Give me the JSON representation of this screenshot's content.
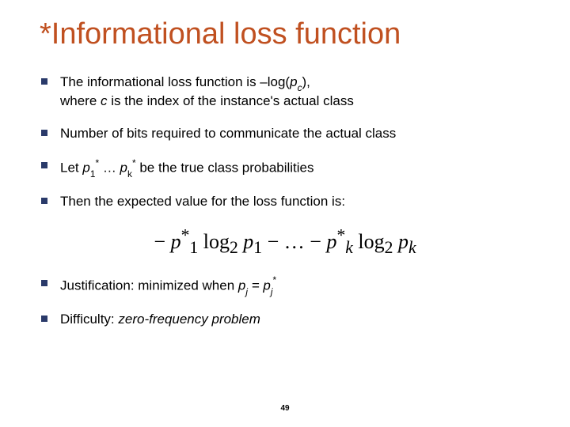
{
  "title": "*Informational loss function",
  "bullets": {
    "b1a": "The informational loss function is –log(",
    "b1_pc_p": "p",
    "b1_pc_c": "c",
    "b1b": "),",
    "b1c": "where ",
    "b1_c": "c",
    "b1d": " is the index of the instance's actual class",
    "b2": "Number of bits required to communicate the actual class",
    "b3a": "Let ",
    "b3_p": "p",
    "b3_1": "1",
    "b3_star": "*",
    "b3_mid": " … ",
    "b3_k": "k",
    "b3b": " be the true class probabilities",
    "b4": "Then the expected value for the loss function is:",
    "b5a": "Justification: minimized when ",
    "b5_pj_p": "p",
    "b5_pj_j": "j",
    "b5_eq": " = ",
    "b5_pjs_p": "p",
    "b5_pjs_j": "j",
    "b5_pjs_star": "*",
    "b6a": "Difficulty: ",
    "b6b": "zero-frequency problem"
  },
  "formula": {
    "minus1": "− ",
    "p": "p",
    "one": "1",
    "star": "*",
    "sp": " ",
    "log2": "log",
    "two": "2",
    "mid": " − … − ",
    "k": "k"
  },
  "page": "49"
}
